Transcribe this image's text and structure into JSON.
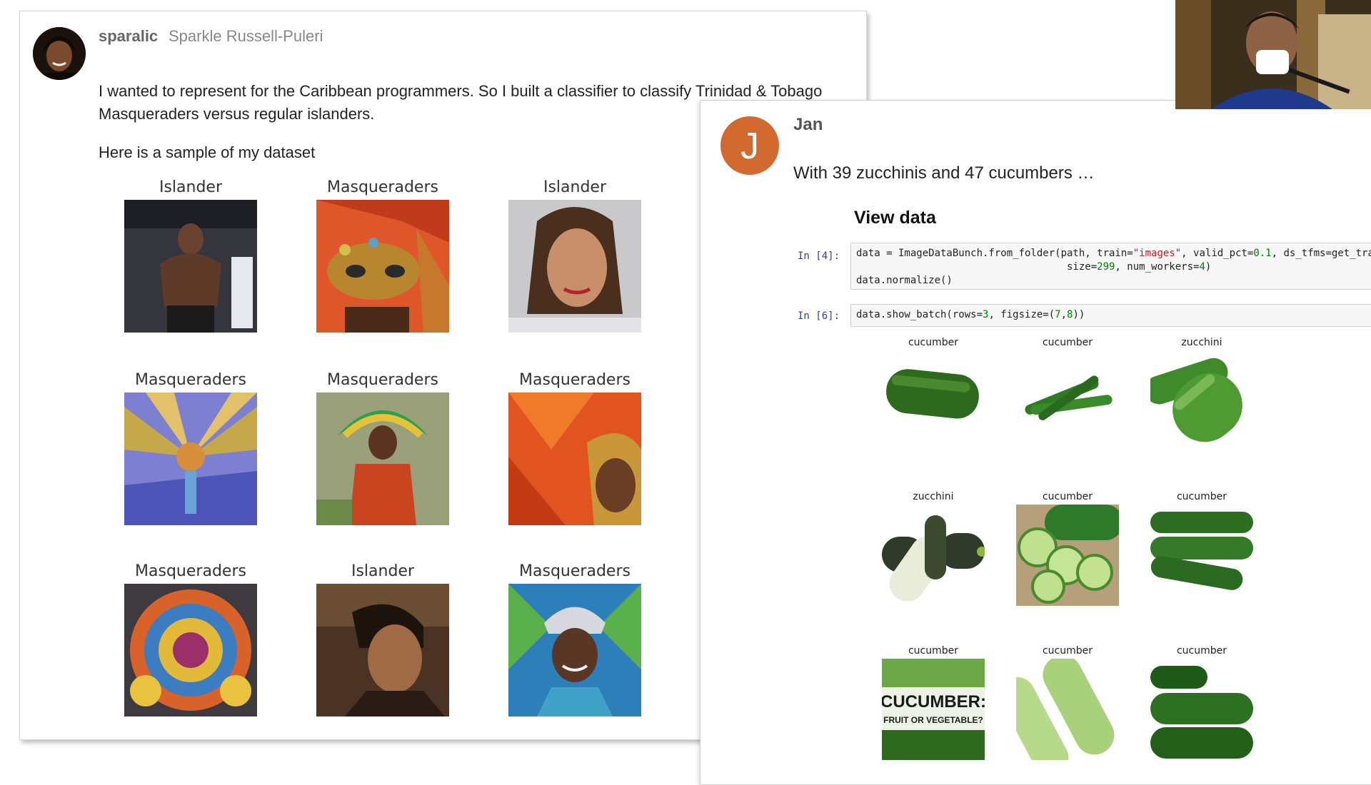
{
  "post_a": {
    "username": "sparalic",
    "fullname": "Sparkle Russell-Puleri",
    "paragraph1_line1": "I wanted to represent for the Caribbean programmers. So I built a classifier to classify Trinidad & Tobago",
    "paragraph1_line2": "Masqueraders versus regular islanders.",
    "paragraph2": "Here is a sample of my dataset",
    "grid": [
      {
        "label": "Islander"
      },
      {
        "label": "Masqueraders"
      },
      {
        "label": "Islander"
      },
      {
        "label": "Masqueraders"
      },
      {
        "label": "Masqueraders"
      },
      {
        "label": "Masqueraders"
      },
      {
        "label": "Masqueraders"
      },
      {
        "label": "Islander"
      },
      {
        "label": "Masqueraders"
      }
    ]
  },
  "post_b": {
    "avatar_letter": "J",
    "name": "Jan",
    "message": "With 39 zucchinis and 47 cucumbers …",
    "section_title": "View data",
    "cell1_prompt": "In [4]:",
    "cell2_prompt": "In [6]:",
    "code1": {
      "a": "data = ImageDataBunch.from_folder(path, train=",
      "s1": "\"images\"",
      "b": ", valid_pct=",
      "n1": "0.1",
      "c": ", ds_tfms=get_transforms(),",
      "d": "                                   size=",
      "n2": "299",
      "e": ", num_workers=",
      "n3": "4",
      "f": ")",
      "line3": "data.normalize()"
    },
    "code2": {
      "a": "data.show_batch(rows=",
      "n1": "3",
      "b": ", figsize=(",
      "n2": "7",
      "c": ",",
      "n3": "8",
      "d": "))"
    },
    "batch": [
      {
        "label": "cucumber"
      },
      {
        "label": "cucumber"
      },
      {
        "label": "zucchini"
      },
      {
        "label": "zucchini"
      },
      {
        "label": "cucumber"
      },
      {
        "label": "cucumber"
      },
      {
        "label": "cucumber",
        "overlay_1": "CUCUMBER:",
        "overlay_2": "FRUIT OR VEGETABLE?"
      },
      {
        "label": "cucumber"
      },
      {
        "label": "cucumber"
      }
    ]
  },
  "colors": {
    "avatar_orange": "#d2692e",
    "prompt_blue": "#303f9f",
    "string_red": "#ba2121",
    "number_green": "#008000"
  },
  "icons": [
    "avatar-photo",
    "avatar-letter",
    "webcam-video"
  ]
}
